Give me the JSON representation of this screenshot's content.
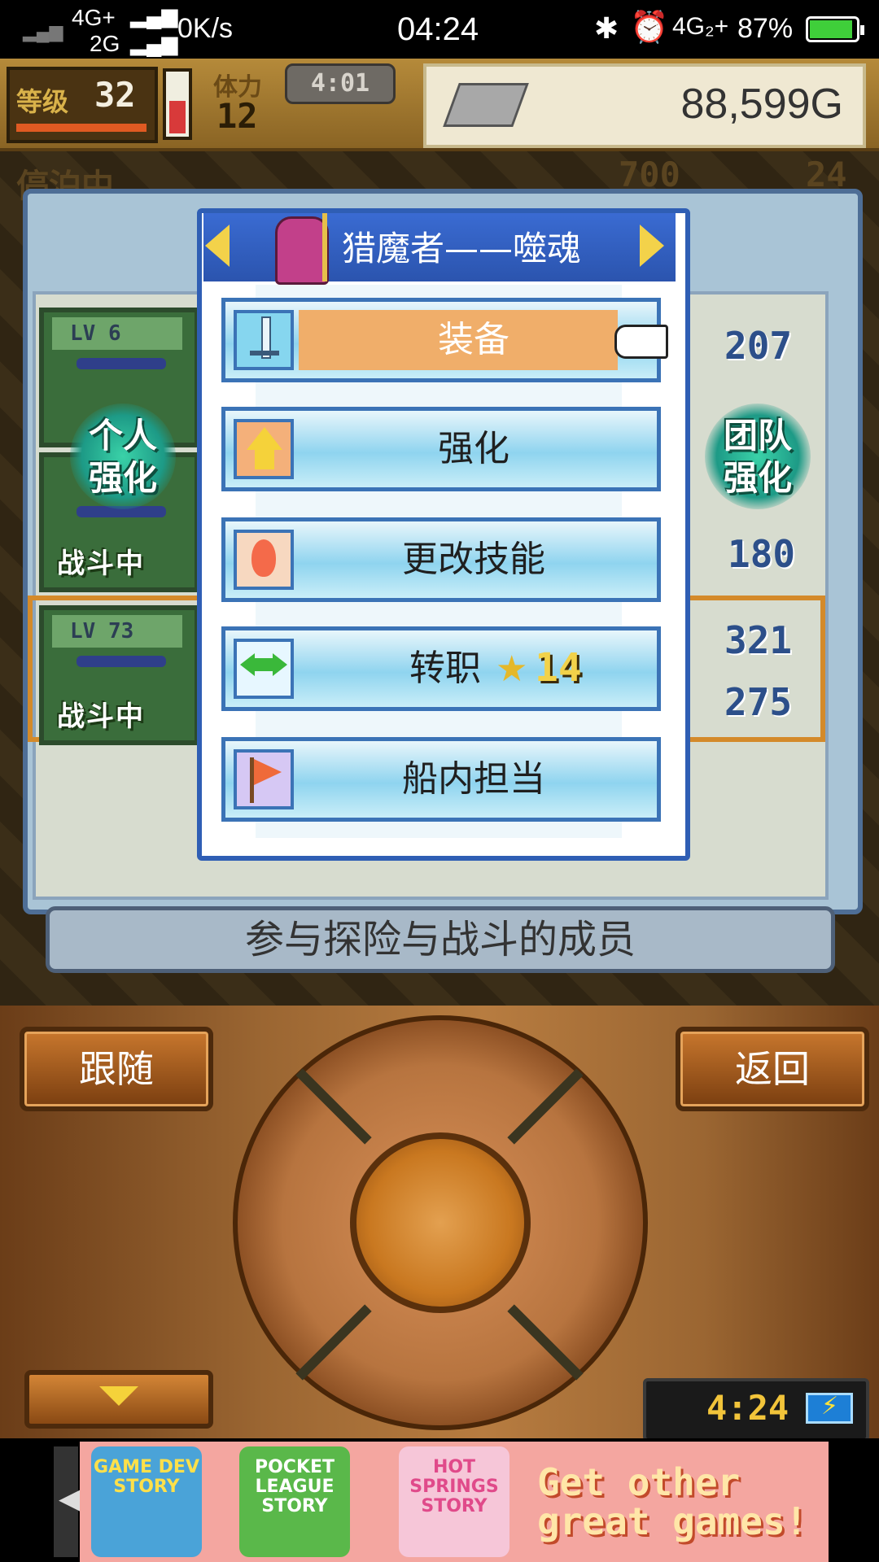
{
  "status_bar": {
    "network_1": "4G+",
    "network_2": "2G",
    "speed": "0K/s",
    "time": "04:24",
    "network_right": "4G₂+",
    "battery_percent": "87%"
  },
  "hud": {
    "level_label": "等级",
    "level_value": "32",
    "stamina_label": "体力",
    "stamina_value": "12",
    "timer": "4:01",
    "gold": "88,599G",
    "anchor_label": "停泊中",
    "food_value": "700",
    "count_value": "24"
  },
  "members": {
    "cards": [
      {
        "lv": "LV 6",
        "status": ""
      },
      {
        "lv": "",
        "status": "战斗中"
      },
      {
        "lv": "LV 73",
        "status": "战斗中"
      }
    ],
    "stats": [
      "207",
      "180",
      "321",
      "275"
    ],
    "left_badge": "个人\n强化",
    "left_badge_line1": "个人",
    "left_badge_line2": "强化",
    "right_badge_line1": "团队",
    "right_badge_line2": "强化",
    "caption": "参与探险与战斗的成员"
  },
  "menu": {
    "character_name": "猎魔者——噬魂",
    "items": [
      {
        "label": "装备",
        "icon": "sword-icon",
        "selected": true
      },
      {
        "label": "强化",
        "icon": "up-arrow-icon",
        "selected": false
      },
      {
        "label": "更改技能",
        "icon": "flame-icon",
        "selected": false
      },
      {
        "label": "转职",
        "icon": "swap-arrows-icon",
        "selected": false,
        "cost": "14"
      },
      {
        "label": "船内担当",
        "icon": "flag-icon",
        "selected": false
      }
    ]
  },
  "controller": {
    "follow_label": "跟随",
    "back_label": "返回",
    "clock": "4:24"
  },
  "ad": {
    "tile_1": "GAME DEV STORY",
    "tile_2": "POCKET LEAGUE STORY",
    "tile_3": "HOT SPRINGS STORY",
    "text": "Get other great games!"
  }
}
